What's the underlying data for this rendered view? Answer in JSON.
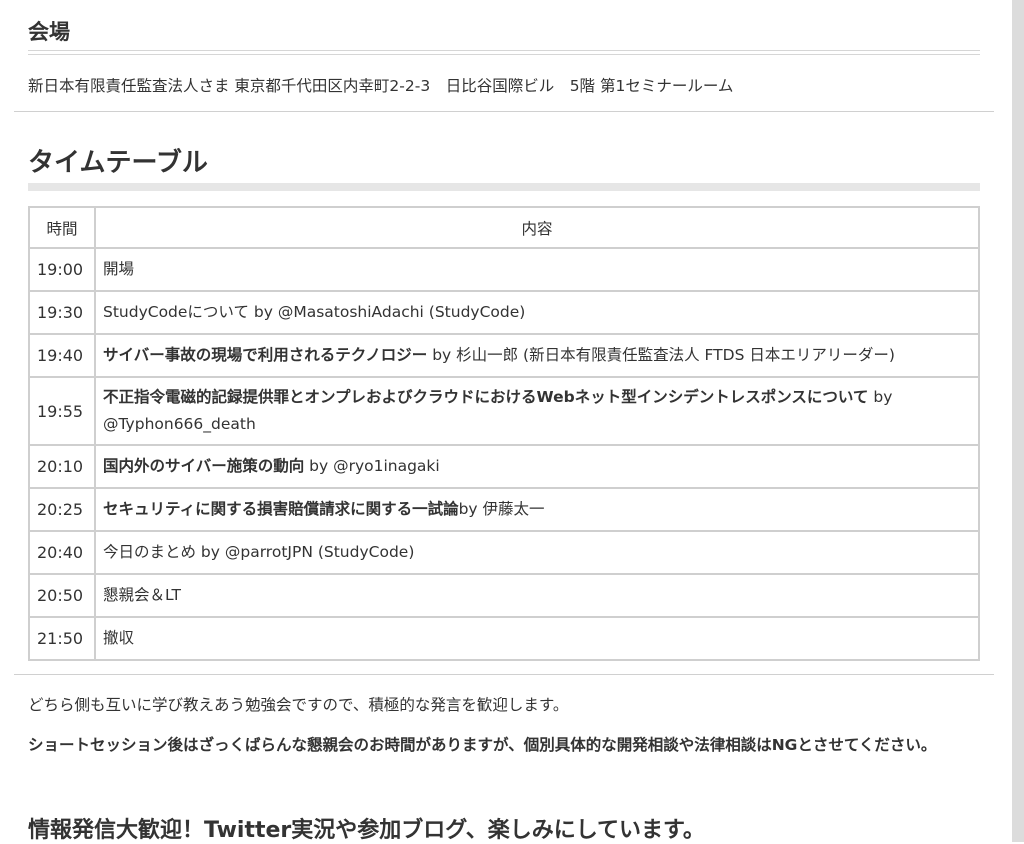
{
  "venue": {
    "heading": "会場",
    "address": "新日本有限責任監査法人さま 東京都千代田区内幸町2-2-3　日比谷国際ビル　5階 第1セミナールーム"
  },
  "timetable": {
    "heading": "タイムテーブル",
    "columns": [
      "時間",
      "内容"
    ],
    "rows": [
      {
        "time": "19:00",
        "title": "",
        "rest": "開場"
      },
      {
        "time": "19:30",
        "title": "",
        "rest": "StudyCodeについて by @MasatoshiAdachi (StudyCode)"
      },
      {
        "time": "19:40",
        "title": "サイバー事故の現場で利用されるテクノロジー",
        "rest": " by 杉山一郎 (新日本有限責任監査法人 FTDS 日本エリアリーダー)"
      },
      {
        "time": "19:55",
        "title": "不正指令電磁的記録提供罪とオンプレおよびクラウドにおけるWebネット型インシデントレスポンスについて",
        "rest": " by @Typhon666_death"
      },
      {
        "time": "20:10",
        "title": "国内外のサイバー施策の動向",
        "rest": " by @ryo1inagaki"
      },
      {
        "time": "20:25",
        "title": "セキュリティに関する損害賠償請求に関する一試論",
        "rest": "by 伊藤太一"
      },
      {
        "time": "20:40",
        "title": "",
        "rest": "今日のまとめ by @parrotJPN (StudyCode)"
      },
      {
        "time": "20:50",
        "title": "",
        "rest": "懇親会＆LT"
      },
      {
        "time": "21:50",
        "title": "",
        "rest": "撤収"
      }
    ]
  },
  "notes": {
    "line1": "どちら側も互いに学び教えあう勉強会ですので、積極的な発言を歓迎します。",
    "line2": "ショートセッション後はざっくばらんな懇親会のお時間がありますが、個別具体的な開発相談や法律相談はNGとさせてください。"
  },
  "closing": "情報発信大歓迎！Twitter実況や参加ブログ、楽しみにしています。"
}
